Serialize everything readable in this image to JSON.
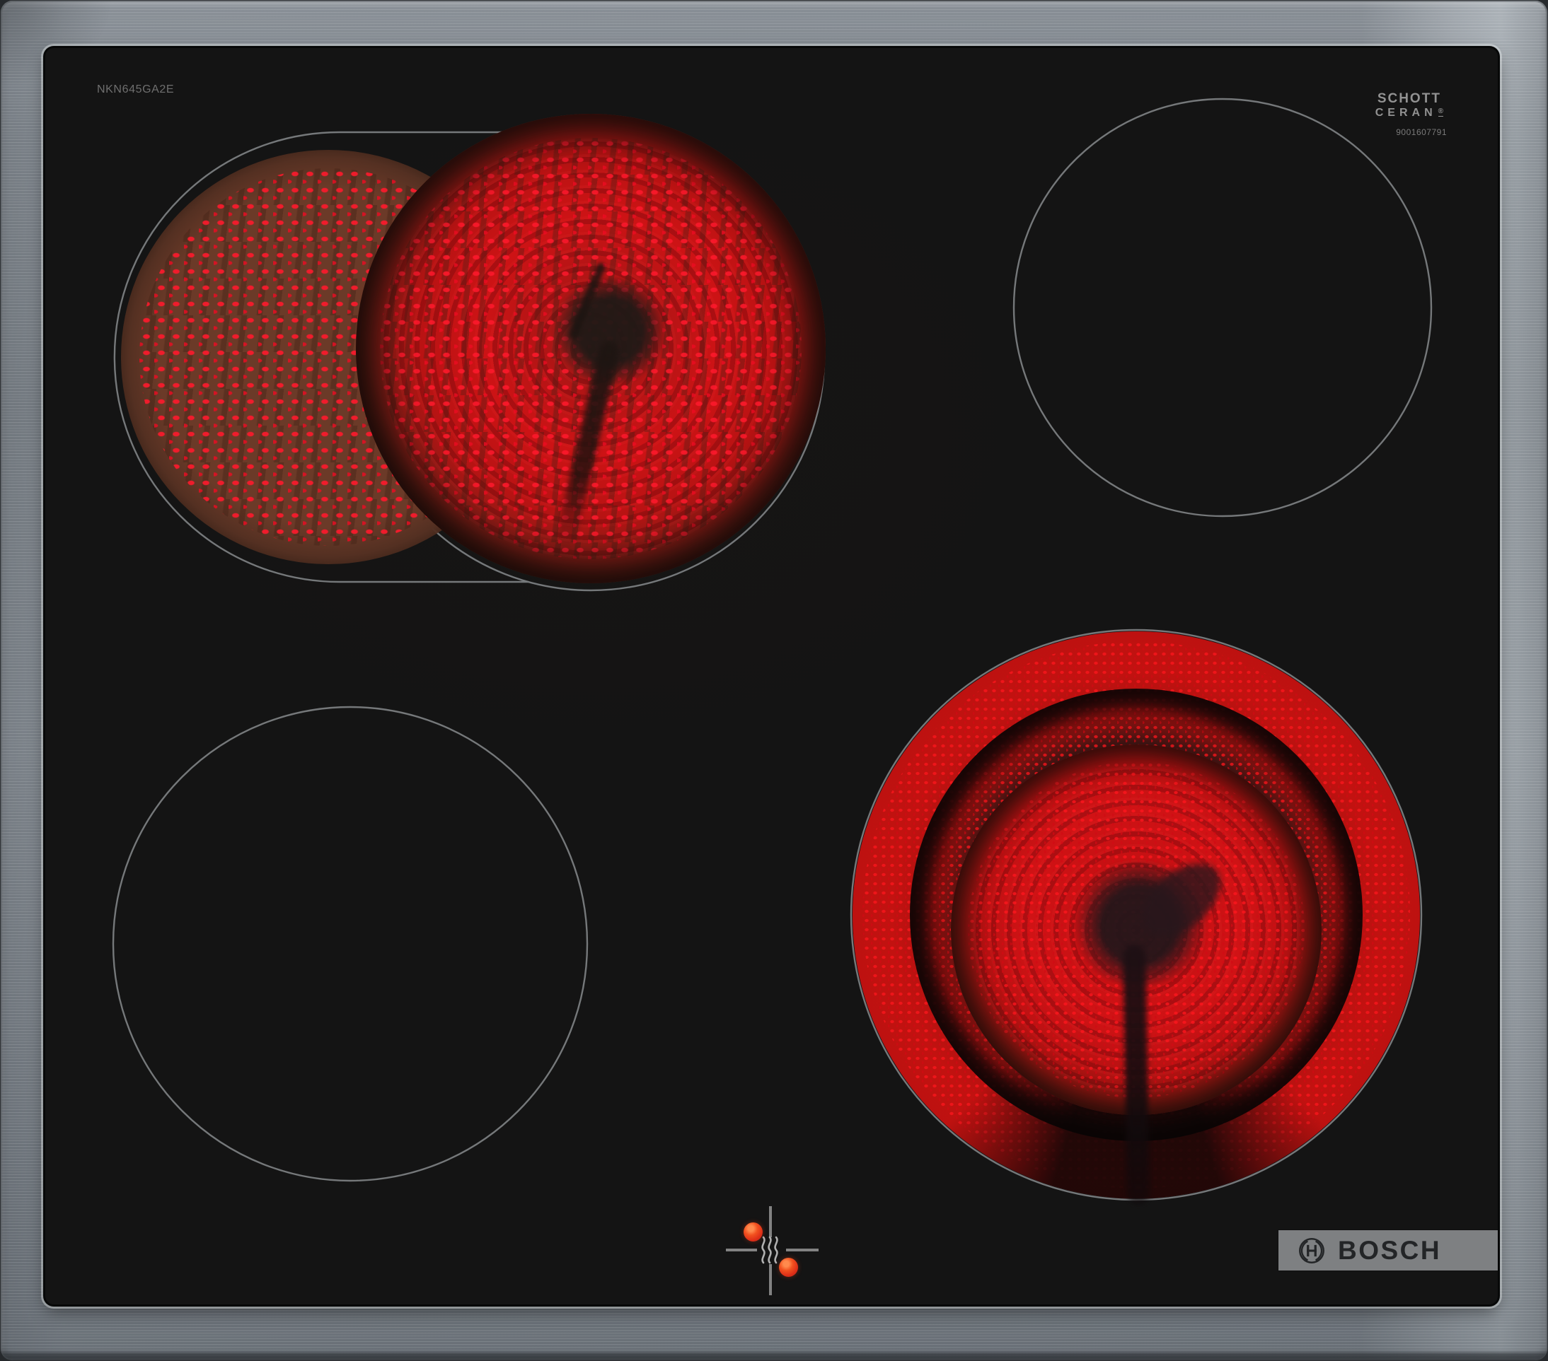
{
  "device": {
    "type": "electric ceramic hob",
    "frame": "stainless steel",
    "surface": "black glass ceramic"
  },
  "markings": {
    "model_number": "NKN645GA2E",
    "glass_brand_line1": "SCHOTT",
    "glass_brand_line2": "CERAN",
    "glass_brand_reg": "®",
    "serial_number": "9001607791",
    "brand": "BOSCH"
  },
  "zones": [
    {
      "id": "rear-left",
      "shape": "dual-circuit extendable",
      "state": "on",
      "glow": "red radiant coil, crescent extension + main circle"
    },
    {
      "id": "rear-right",
      "shape": "single circle",
      "state": "off"
    },
    {
      "id": "front-left",
      "shape": "single circle",
      "state": "off"
    },
    {
      "id": "front-right",
      "shape": "dual-circuit circle",
      "state": "on",
      "glow": "red radiant coil, outer ring + inner disc"
    }
  ],
  "indicators": {
    "residual_heat_icon": "triple-wave",
    "alignment_cross": "crosshair with center gap",
    "heat_dots_count": 2
  },
  "icons": [
    "bosch-emblem-icon",
    "residual-heat-icon"
  ],
  "colors": {
    "glass_black": "#141414",
    "zone_outline_gray": "#75787a",
    "glow_red_bright": "#d01315",
    "glow_red_deep": "#8d1b13",
    "glow_halo_brown": "#6b3a28",
    "steel_light": "#c7cbd0",
    "steel_dark": "#969ca2",
    "badge_gray": "#7e8082",
    "badge_text": "#232527",
    "marking_gray": "#6f6f6f",
    "heat_dot_orange": "#f2511f"
  }
}
